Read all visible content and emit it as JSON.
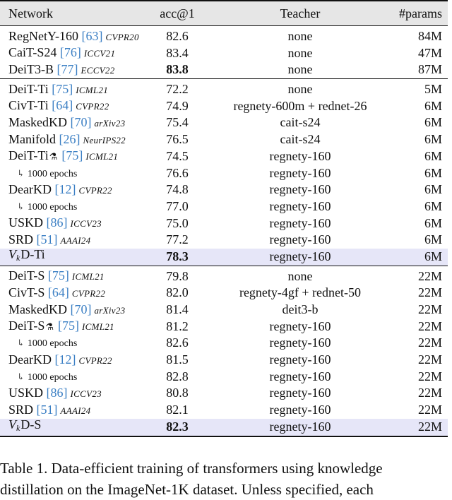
{
  "table": {
    "headers": {
      "network": "Network",
      "acc": "acc@1",
      "teacher": "Teacher",
      "params": "#params"
    },
    "groups": [
      {
        "rows": [
          {
            "name": "RegNetY-160",
            "cite": "[63]",
            "venue": "CVPR20",
            "acc": "82.6",
            "teacher": "none",
            "params": "84M"
          },
          {
            "name": "CaiT-S24",
            "cite": "[76]",
            "venue": "ICCV21",
            "acc": "83.4",
            "teacher": "none",
            "params": "47M"
          },
          {
            "name": "DeiT3-B",
            "cite": "[77]",
            "venue": "ECCV22",
            "acc": "83.8",
            "acc_bold": true,
            "teacher": "none",
            "params": "87M"
          }
        ]
      },
      {
        "rows": [
          {
            "name": "DeiT-Ti",
            "cite": "[75]",
            "venue": "ICML21",
            "acc": "72.2",
            "teacher": "none",
            "params": "5M"
          },
          {
            "name": "CivT-Ti",
            "cite": "[64]",
            "venue": "CVPR22",
            "acc": "74.9",
            "teacher": "regnety-600m + rednet-26",
            "params": "6M"
          },
          {
            "name": "MaskedKD",
            "cite": "[70]",
            "venue": "arXiv23",
            "acc": "75.4",
            "teacher": "cait-s24",
            "params": "6M"
          },
          {
            "name": "Manifold",
            "cite": "[26]",
            "venue": "NeurIPS22",
            "acc": "76.5",
            "teacher": "cait-s24",
            "params": "6M"
          },
          {
            "name": "DeiT-Ti",
            "alembic": "⚗",
            "cite": "[75]",
            "venue": "ICML21",
            "acc": "74.5",
            "teacher": "regnety-160",
            "params": "6M"
          },
          {
            "sub": "1000 epochs",
            "arrow": "↳",
            "acc": "76.6",
            "teacher": "regnety-160",
            "params": "6M"
          },
          {
            "name": "DearKD",
            "cite": "[12]",
            "venue": "CVPR22",
            "acc": "74.8",
            "teacher": "regnety-160",
            "params": "6M"
          },
          {
            "sub": "1000 epochs",
            "arrow": "↳",
            "acc": "77.0",
            "teacher": "regnety-160",
            "params": "6M"
          },
          {
            "name": "USKD",
            "cite": "[86]",
            "venue": "ICCV23",
            "acc": "75.0",
            "teacher": "regnety-160",
            "params": "6M"
          },
          {
            "name": "SRD",
            "cite": "[51]",
            "venue": "AAAI24",
            "acc": "77.2",
            "teacher": "regnety-160",
            "params": "6M"
          },
          {
            "vk": true,
            "vk_v": "V",
            "vk_k": "k",
            "vk_suffix": "D-Ti",
            "acc": "78.3",
            "acc_bold": true,
            "teacher": "regnety-160",
            "params": "6M",
            "highlight": true
          }
        ]
      },
      {
        "rows": [
          {
            "name": "DeiT-S",
            "cite": "[75]",
            "venue": "ICML21",
            "acc": "79.8",
            "teacher": "none",
            "params": "22M"
          },
          {
            "name": "CivT-S",
            "cite": "[64]",
            "venue": "CVPR22",
            "acc": "82.0",
            "teacher": "regnety-4gf + rednet-50",
            "params": "22M"
          },
          {
            "name": "MaskedKD",
            "cite": "[70]",
            "venue": "arXiv23",
            "acc": "81.4",
            "teacher": "deit3-b",
            "params": "22M"
          },
          {
            "name": "DeiT-S",
            "alembic": "⚗",
            "cite": "[75]",
            "venue": "ICML21",
            "acc": "81.2",
            "teacher": "regnety-160",
            "params": "22M"
          },
          {
            "sub": "1000 epochs",
            "arrow": "↳",
            "acc": "82.6",
            "teacher": "regnety-160",
            "params": "22M"
          },
          {
            "name": "DearKD",
            "cite": "[12]",
            "venue": "CVPR22",
            "acc": "81.5",
            "teacher": "regnety-160",
            "params": "22M"
          },
          {
            "sub": "1000 epochs",
            "arrow": "↳",
            "acc": "82.8",
            "teacher": "regnety-160",
            "params": "22M"
          },
          {
            "name": "USKD",
            "cite": "[86]",
            "venue": "ICCV23",
            "acc": "80.8",
            "teacher": "regnety-160",
            "params": "22M"
          },
          {
            "name": "SRD",
            "cite": "[51]",
            "venue": "AAAI24",
            "acc": "82.1",
            "teacher": "regnety-160",
            "params": "22M"
          },
          {
            "vk": true,
            "vk_v": "V",
            "vk_k": "k",
            "vk_suffix": "D-S",
            "acc": "82.3",
            "acc_bold": true,
            "teacher": "regnety-160",
            "params": "22M",
            "highlight": true
          }
        ]
      }
    ],
    "highlight_color": "#e6e6f8",
    "header_color": "#e6e6e6",
    "cite_color": "#3b7fc4"
  },
  "caption": {
    "line1": "Table 1.  Data-efficient training of transformers using knowledge",
    "line2": "distillation on the ImageNet-1K dataset. Unless specified, each"
  }
}
